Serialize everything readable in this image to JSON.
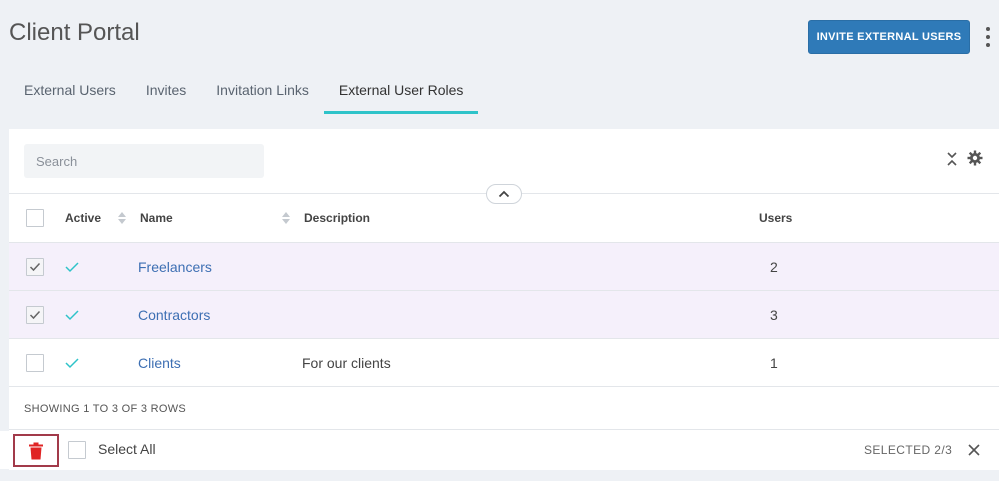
{
  "header": {
    "title": "Client Portal",
    "invite_button": "INVITE EXTERNAL USERS",
    "accent_color": "#2f7ab8"
  },
  "tabs": [
    {
      "label": "External Users",
      "active": false
    },
    {
      "label": "Invites",
      "active": false
    },
    {
      "label": "Invitation Links",
      "active": false
    },
    {
      "label": "External User Roles",
      "active": true
    }
  ],
  "toolbar": {
    "search_placeholder": "Search",
    "icons": [
      "collapse-icon",
      "gear-icon",
      "chevron-up-icon"
    ]
  },
  "table": {
    "columns": {
      "active": "Active",
      "name": "Name",
      "description": "Description",
      "users": "Users"
    },
    "rows": [
      {
        "checked": true,
        "active": true,
        "name": "Freelancers",
        "description": "",
        "users": "2"
      },
      {
        "checked": true,
        "active": true,
        "name": "Contractors",
        "description": "",
        "users": "3"
      },
      {
        "checked": false,
        "active": true,
        "name": "Clients",
        "description": "For our clients",
        "users": "1"
      }
    ],
    "footer": "SHOWING 1 TO 3 OF 3 ROWS"
  },
  "action_bar": {
    "select_all_label": "Select All",
    "selected_count": "SELECTED 2/3",
    "delete_icon_color": "#e02424"
  }
}
